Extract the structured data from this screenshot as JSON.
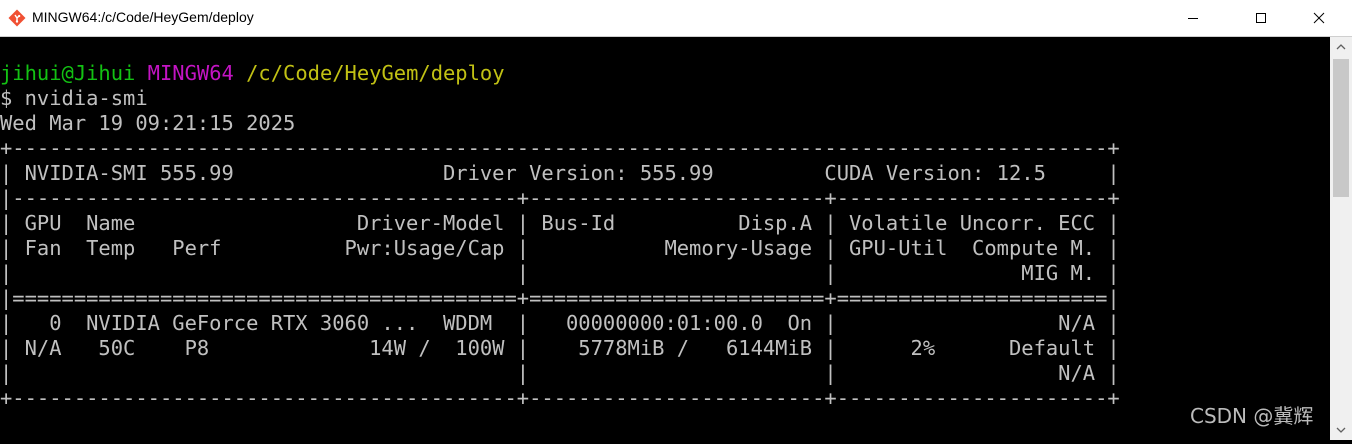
{
  "window": {
    "title": "MINGW64:/c/Code/HeyGem/deploy",
    "app_icon": "git-bash-icon",
    "controls": {
      "minimize": "minimize-icon",
      "maximize": "maximize-icon",
      "close": "close-icon"
    }
  },
  "prompt": {
    "user_host": "jihui@Jihui",
    "shell": "MINGW64",
    "path": "/c/Code/HeyGem/deploy",
    "command": "$ nvidia-smi"
  },
  "date_line": "Wed Mar 19 09:21:15 2025",
  "smi_table": [
    "+-----------------------------------------------------------------------------------------+",
    "| NVIDIA-SMI 555.99                 Driver Version: 555.99         CUDA Version: 12.5     |",
    "|-----------------------------------------+------------------------+----------------------+",
    "| GPU  Name                  Driver-Model | Bus-Id          Disp.A | Volatile Uncorr. ECC |",
    "| Fan  Temp   Perf          Pwr:Usage/Cap |           Memory-Usage | GPU-Util  Compute M. |",
    "|                                         |                        |               MIG M. |",
    "|=========================================+========================+======================|",
    "|   0  NVIDIA GeForce RTX 3060 ...  WDDM  |   00000000:01:00.0  On |                  N/A |",
    "| N/A   50C    P8             14W /  100W |    5778MiB /   6144MiB |      2%      Default |",
    "|                                         |                        |                  N/A |",
    "+-----------------------------------------+------------------------+----------------------+"
  ],
  "watermark": "CSDN @冀辉",
  "colors": {
    "background": "#000000",
    "text": "#c0c0c0",
    "user_host": "#13c213",
    "shell": "#c414c4",
    "path": "#c1c114"
  }
}
